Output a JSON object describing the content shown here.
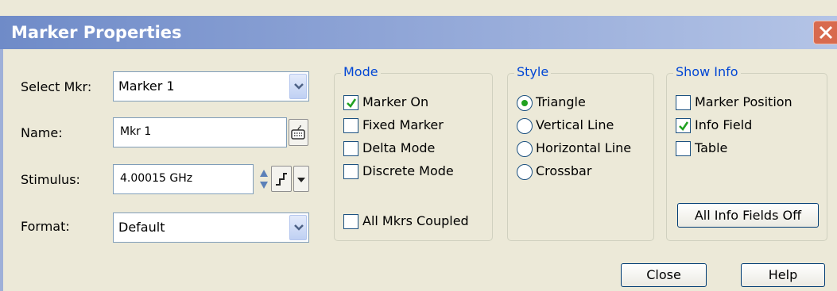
{
  "window": {
    "title": "Marker Properties"
  },
  "fields": {
    "select_mkr": {
      "label": "Select Mkr:",
      "value": "Marker 1"
    },
    "name": {
      "label": "Name:",
      "value": "Mkr 1"
    },
    "stimulus": {
      "label": "Stimulus:",
      "value": "4.00015 GHz"
    },
    "format": {
      "label": "Format:",
      "value": "Default"
    }
  },
  "mode": {
    "title": "Mode",
    "items": [
      {
        "label": "Marker On",
        "checked": true
      },
      {
        "label": "Fixed Marker",
        "checked": false
      },
      {
        "label": "Delta Mode",
        "checked": false
      },
      {
        "label": "Discrete Mode",
        "checked": false
      }
    ],
    "coupled": {
      "label": "All Mkrs Coupled",
      "checked": false
    }
  },
  "style": {
    "title": "Style",
    "options": [
      {
        "label": "Triangle",
        "selected": true
      },
      {
        "label": "Vertical Line",
        "selected": false
      },
      {
        "label": "Horizontal Line",
        "selected": false
      },
      {
        "label": "Crossbar",
        "selected": false
      }
    ]
  },
  "show_info": {
    "title": "Show Info",
    "items": [
      {
        "label": "Marker Position",
        "checked": false
      },
      {
        "label": "Info Field",
        "checked": true
      },
      {
        "label": "Table",
        "checked": false
      }
    ],
    "all_off_label": "All Info Fields Off"
  },
  "buttons": {
    "close_label": "Close",
    "help_label": "Help"
  },
  "colors": {
    "group_title": "#0046d5",
    "check_mark": "#21a121",
    "title_bar": "#6f8bc8"
  }
}
